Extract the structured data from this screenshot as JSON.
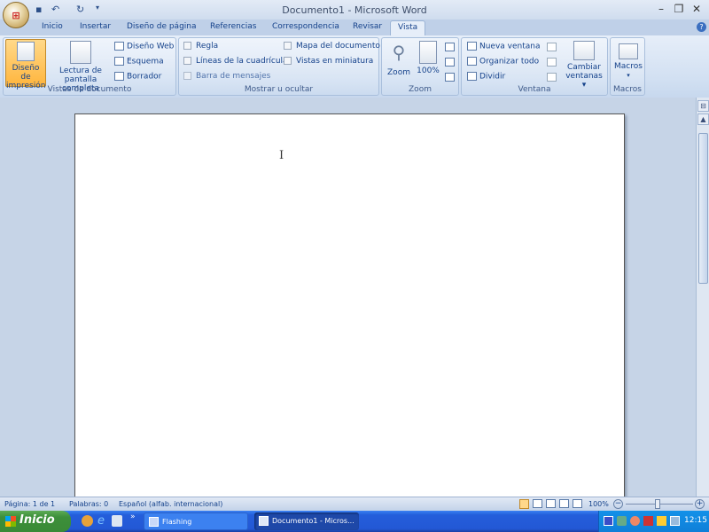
{
  "title": "Documento1 - Microsoft Word",
  "quick_access": {
    "save": "save-icon",
    "undo": "undo-icon",
    "redo": "redo-icon",
    "customize": "▾"
  },
  "tabs": [
    "Inicio",
    "Insertar",
    "Diseño de página",
    "Referencias",
    "Correspondencia",
    "Revisar",
    "Vista"
  ],
  "active_tab": "Vista",
  "ribbon": {
    "vistas": {
      "label": "Vistas de documento",
      "print_layout_l1": "Diseño de",
      "print_layout_l2": "impresión",
      "fullscreen_l1": "Lectura de",
      "fullscreen_l2": "pantalla completa",
      "web": "Diseño Web",
      "outline": "Esquema",
      "draft": "Borrador"
    },
    "mostrar": {
      "label": "Mostrar u ocultar",
      "ruler": "Regla",
      "gridlines": "Líneas de la cuadrícula",
      "message_bar": "Barra de mensajes",
      "doc_map": "Mapa del documento",
      "thumbnails": "Vistas en miniatura"
    },
    "zoom": {
      "label": "Zoom",
      "zoom": "Zoom",
      "hundred": "100%"
    },
    "ventana": {
      "label": "Ventana",
      "new_window": "Nueva ventana",
      "arrange_all": "Organizar todo",
      "split": "Dividir",
      "switch_l1": "Cambiar",
      "switch_l2": "ventanas ▾"
    },
    "macros": {
      "label": "Macros",
      "macros": "Macros",
      "arrow": "▾"
    }
  },
  "status": {
    "page": "Página: 1 de 1",
    "words": "Palabras: 0",
    "language": "Español (alfab. internacional)",
    "zoom": "100%"
  },
  "taskbar": {
    "start": "Inicio",
    "items": [
      "Flashing",
      "Documento1 - Micros..."
    ],
    "clock": "12:15",
    "chevron": "»"
  }
}
